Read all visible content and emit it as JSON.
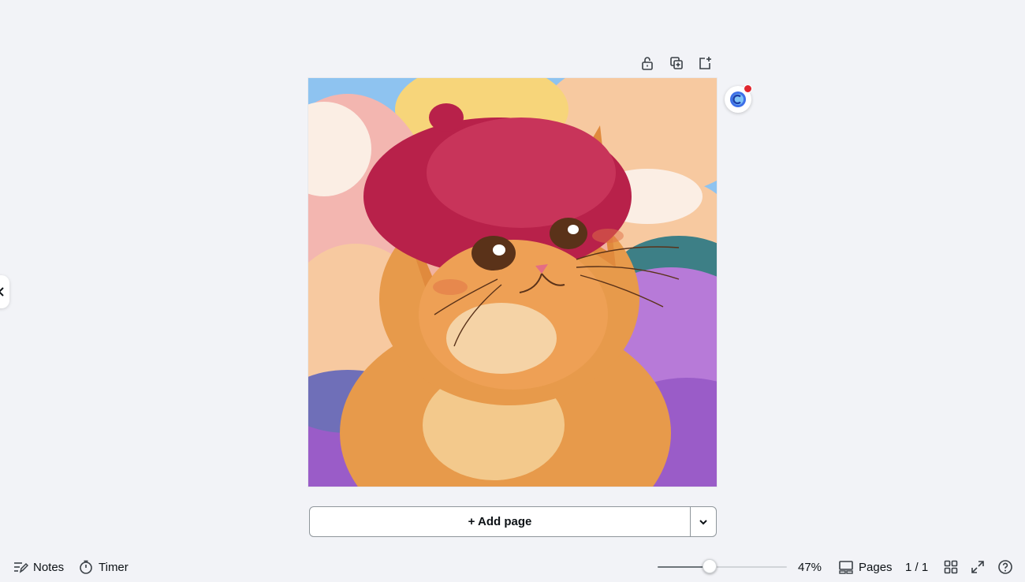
{
  "sidebar_toggle": {
    "icon": "chevron-left-icon"
  },
  "page_toolbar": {
    "lock_icon": "lock-icon",
    "duplicate_icon": "duplicate-page-icon",
    "add_icon": "add-page-icon"
  },
  "canvas": {
    "image_description": "cat-in-beret-illustration",
    "colors": {
      "sky": "#8ec3f0",
      "cloud_peach": "#f7c9a0",
      "cloud_pink": "#f3b6b0",
      "hill_purple": "#9a5cc8",
      "hill_teal": "#3d7f86",
      "cat_orange": "#e79a4b",
      "cat_light": "#f3c98c",
      "beret": "#b8214a"
    }
  },
  "assistant": {
    "icon": "assistant-icon",
    "has_notification": true
  },
  "add_page": {
    "label": "+ Add page",
    "dropdown_icon": "chevron-down-icon"
  },
  "footer": {
    "notes_label": "Notes",
    "timer_label": "Timer",
    "zoom_value": 0.4,
    "zoom_label": "47%",
    "pages_label": "Pages",
    "page_counter": "1 / 1",
    "grid_icon": "grid-view-icon",
    "fullscreen_icon": "fullscreen-icon",
    "help_icon": "help-icon"
  }
}
